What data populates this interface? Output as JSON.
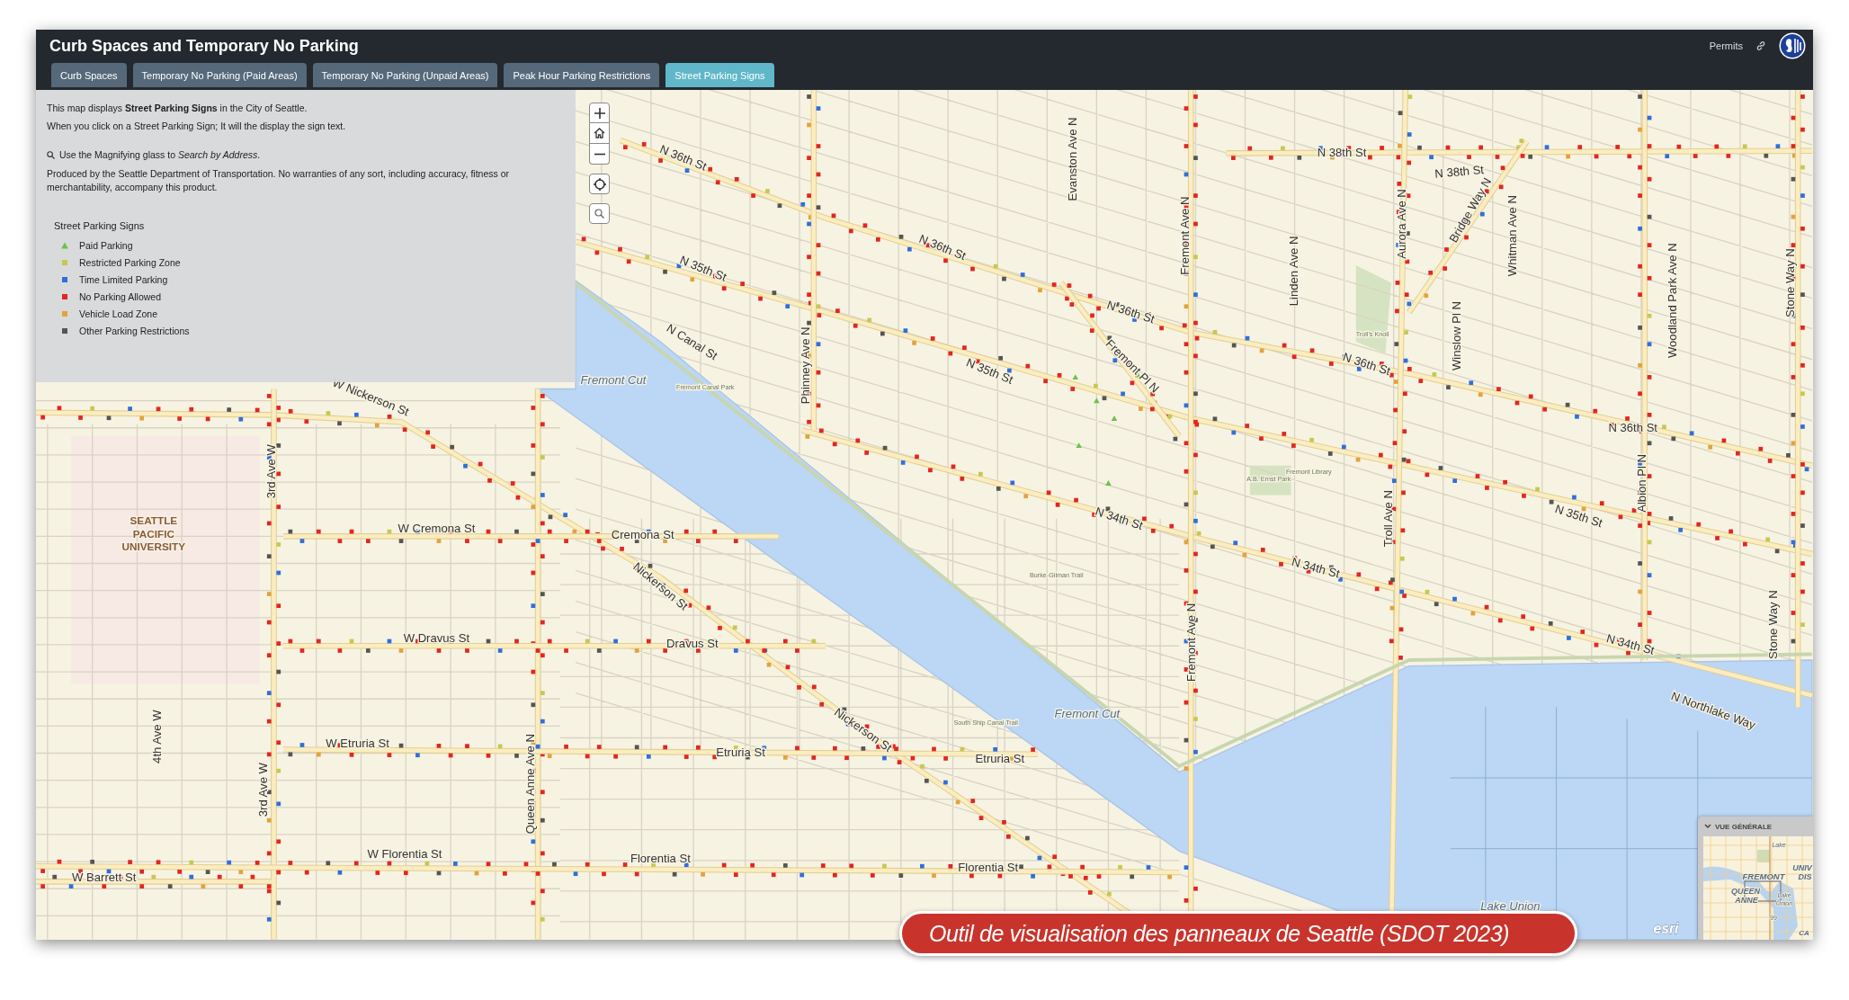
{
  "header": {
    "title": "Curb Spaces and Temporary No Parking",
    "link": "Permits"
  },
  "tabs": [
    {
      "label": "Curb Spaces",
      "selected": false
    },
    {
      "label": "Temporary No Parking (Paid Areas)",
      "selected": false
    },
    {
      "label": "Temporary No Parking (Unpaid Areas)",
      "selected": false
    },
    {
      "label": "Peak Hour Parking Restrictions",
      "selected": false
    },
    {
      "label": "Street Parking Signs",
      "selected": true
    }
  ],
  "info_panel": {
    "paragraphs": [
      "This map displays **Street Parking Signs** in the City of Seattle.",
      "When you click on a Street Parking Sign; It will the display the sign text."
    ],
    "search_hint": "Use the Magnifying glass to *Search by Address*.",
    "disclaimer": "Produced by the Seattle Department of Transportation. No warranties of any sort, including accuracy, fitness or merchantability, accompany this product.",
    "legend": {
      "title": "Street Parking Signs",
      "items": [
        {
          "label": "Paid Parking",
          "kind": "triangle",
          "color": "#6cc24a"
        },
        {
          "label": "Restricted Parking Zone",
          "kind": "square",
          "color": "#c8c84e"
        },
        {
          "label": "Time Limited Parking",
          "kind": "square",
          "color": "#2f6fdb"
        },
        {
          "label": "No Parking Allowed",
          "kind": "square",
          "color": "#e3261f"
        },
        {
          "label": "Vehicle Load Zone",
          "kind": "square",
          "color": "#e5a23a"
        },
        {
          "label": "Other Parking Restrictions",
          "kind": "square",
          "color": "#555555"
        }
      ]
    }
  },
  "map": {
    "labels": [
      {
        "text": "N 36th St",
        "kind": "street"
      },
      {
        "text": "N 35th St",
        "kind": "street"
      },
      {
        "text": "N Canal St",
        "kind": "street"
      },
      {
        "text": "Fremont Cut",
        "kind": "water"
      },
      {
        "text": "W Nickerson St",
        "kind": "street"
      },
      {
        "text": "N 36th St",
        "kind": "street"
      },
      {
        "text": "Phinney Ave N",
        "kind": "street"
      },
      {
        "text": "N 35th St",
        "kind": "street"
      },
      {
        "text": "Fremont Pl N",
        "kind": "street"
      },
      {
        "text": "N 36th St",
        "kind": "street"
      },
      {
        "text": "N 34th St",
        "kind": "street"
      },
      {
        "text": "Fremont Ave N",
        "kind": "street"
      },
      {
        "text": "N 38th St",
        "kind": "street"
      },
      {
        "text": "N 38th St",
        "kind": "street"
      },
      {
        "text": "Aurora Ave N",
        "kind": "street"
      },
      {
        "text": "Bridge Way N",
        "kind": "street"
      },
      {
        "text": "N 36th St",
        "kind": "street"
      },
      {
        "text": "N 36th St",
        "kind": "street"
      },
      {
        "text": "N 35th St",
        "kind": "street"
      },
      {
        "text": "N 34th St",
        "kind": "street"
      },
      {
        "text": "N 34th St",
        "kind": "street"
      },
      {
        "text": "N Northlake Way",
        "kind": "street"
      },
      {
        "text": "Fremont Ave N",
        "kind": "street"
      },
      {
        "text": "Fremont Cut",
        "kind": "water"
      },
      {
        "text": "W Cremona St",
        "kind": "street"
      },
      {
        "text": "Cremona St",
        "kind": "street"
      },
      {
        "text": "Nickerson St",
        "kind": "street"
      },
      {
        "text": "W Dravus St",
        "kind": "street"
      },
      {
        "text": "Dravus St",
        "kind": "street"
      },
      {
        "text": "Nickerson St",
        "kind": "street"
      },
      {
        "text": "W Etruria St",
        "kind": "street"
      },
      {
        "text": "Etruria St",
        "kind": "street"
      },
      {
        "text": "Etruria St",
        "kind": "street"
      },
      {
        "text": "W Florentia St",
        "kind": "street"
      },
      {
        "text": "Florentia St",
        "kind": "street"
      },
      {
        "text": "Florentia St",
        "kind": "street"
      },
      {
        "text": "W Barrett St",
        "kind": "street"
      },
      {
        "text": "3rd Ave W",
        "kind": "street"
      },
      {
        "text": "3rd Ave W",
        "kind": "street"
      },
      {
        "text": "4th Ave W",
        "kind": "street"
      },
      {
        "text": "Queen Anne Ave N",
        "kind": "street"
      },
      {
        "text": "Stone Way N",
        "kind": "street"
      },
      {
        "text": "Stone Way N",
        "kind": "street"
      },
      {
        "text": "Woodland Park Ave N",
        "kind": "street"
      },
      {
        "text": "Albion Pl N",
        "kind": "street"
      },
      {
        "text": "Linden Ave N",
        "kind": "street"
      },
      {
        "text": "Evanston Ave N",
        "kind": "street"
      },
      {
        "text": "Whitman Ave N",
        "kind": "street"
      },
      {
        "text": "Winslow Pl N",
        "kind": "street"
      },
      {
        "text": "Troll Ave N",
        "kind": "street"
      },
      {
        "text": "Burke-Gilman Trail",
        "kind": "place"
      },
      {
        "text": "South Ship Canal Trail",
        "kind": "place"
      },
      {
        "text": "Fremont Canal Park",
        "kind": "place"
      },
      {
        "text": "Troll's Knoll",
        "kind": "place"
      },
      {
        "text": "A.B. Ernst Park",
        "kind": "place"
      },
      {
        "text": "Fremont Library",
        "kind": "place"
      },
      {
        "text": "SEATTLE PACIFIC UNIVERSITY",
        "kind": "campus"
      },
      {
        "text": "esri",
        "kind": "brand"
      },
      {
        "text": "Lake Union",
        "kind": "water"
      }
    ]
  },
  "overview": {
    "title": "VUE GÉNÉRALE",
    "labels": [
      "Lake",
      "FREMONT",
      "UNIV",
      "DIS",
      "QUEEN",
      "ANNE",
      "Lake",
      "Union",
      "99",
      "CA"
    ]
  },
  "caption": "Outil de visualisation des panneaux de Seattle (SDOT 2023)"
}
